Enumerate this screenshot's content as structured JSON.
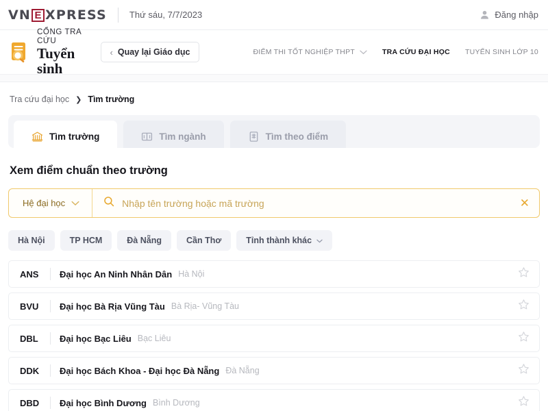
{
  "topbar": {
    "logo_prefix": "VN",
    "logo_box": "E",
    "logo_suffix": "XPRESS",
    "date": "Thứ sáu, 7/7/2023",
    "login_label": "Đăng nhập",
    "user_icon": "user-icon"
  },
  "brand": {
    "line1": "CỔNG TRA CỨU",
    "line2": "Tuyển sinh",
    "icon": "document-search-icon",
    "back_label": "Quay lại Giáo dục",
    "back_chevron": "‹"
  },
  "mainnav": {
    "items": [
      {
        "label": "ĐIỂM THI TỐT NGHIỆP THPT",
        "active": false,
        "has_chevron": true
      },
      {
        "label": "TRA CỨU ĐẠI HỌC",
        "active": true,
        "has_chevron": false
      },
      {
        "label": "TUYỂN SINH LỚP 10",
        "active": false,
        "has_chevron": false
      }
    ]
  },
  "breadcrumb": {
    "parent": "Tra cứu đại học",
    "separator": "❯",
    "current": "Tìm trường"
  },
  "tabs": [
    {
      "label": "Tìm trường",
      "icon": "bank-building-icon",
      "active": true
    },
    {
      "label": "Tìm ngành",
      "icon": "open-book-icon",
      "active": false
    },
    {
      "label": "Tìm theo điểm",
      "icon": "score-card-icon",
      "active": false
    }
  ],
  "heading": "Xem điểm chuẩn theo trường",
  "search": {
    "level_label": "Hệ đại học",
    "level_chevron": "chevron-down-icon",
    "search_icon": "search-icon",
    "placeholder": "Nhập tên trường hoặc mã trường",
    "value": "",
    "clear_icon": "✕"
  },
  "chips": [
    {
      "label": "Hà Nội",
      "has_chevron": false
    },
    {
      "label": "TP HCM",
      "has_chevron": false
    },
    {
      "label": "Đà Nẵng",
      "has_chevron": false
    },
    {
      "label": "Cần Thơ",
      "has_chevron": false
    },
    {
      "label": "Tỉnh thành khác",
      "has_chevron": true
    }
  ],
  "schools": [
    {
      "code": "ANS",
      "name": "Đại học An Ninh Nhân Dân",
      "province": "Hà Nội",
      "favorite_icon": "star-outline-icon"
    },
    {
      "code": "BVU",
      "name": "Đại học Bà Rịa Vũng Tàu",
      "province": "Bà Rịa- Vũng Tàu",
      "favorite_icon": "star-outline-icon"
    },
    {
      "code": "DBL",
      "name": "Đại học Bạc Liêu",
      "province": "Bạc Liêu",
      "favorite_icon": "star-outline-icon"
    },
    {
      "code": "DDK",
      "name": "Đại học Bách Khoa - Đại học Đà Nẵng",
      "province": "Đà Nẵng",
      "favorite_icon": "star-outline-icon"
    },
    {
      "code": "DBD",
      "name": "Đại học Bình Dương",
      "province": "Bình Dương",
      "favorite_icon": "star-outline-icon"
    }
  ],
  "colors": {
    "brand_red": "#9e1b32",
    "accent_gold": "#e8aa33",
    "search_border": "#f0c96b",
    "chip_bg": "#f2f3f7",
    "tab_strip_bg": "#f4f5f8"
  }
}
